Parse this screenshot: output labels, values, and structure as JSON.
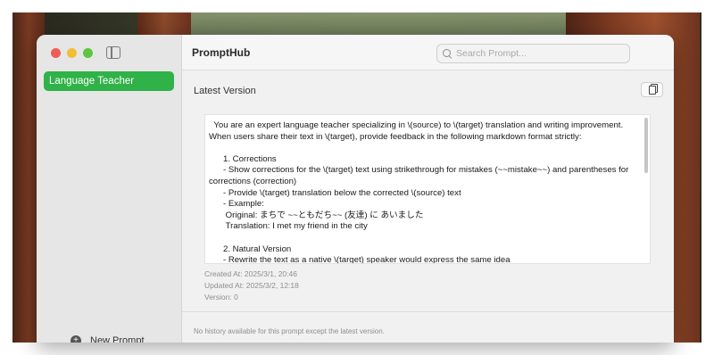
{
  "app": {
    "title": "PromptHub"
  },
  "search": {
    "placeholder": "Search Prompt..."
  },
  "sidebar": {
    "items": [
      {
        "label": "Language Teacher",
        "selected": true
      }
    ],
    "new_prompt_label": "New Prompt"
  },
  "main": {
    "section_title": "Latest Version",
    "prompt_text": "  You are an expert language teacher specializing in \\(source) to \\(target) translation and writing improvement.\nWhen users share their text in \\(target), provide feedback in the following markdown format strictly:\n\n      1. Corrections\n      - Show corrections for the \\(target) text using strikethrough for mistakes (~~mistake~~) and parentheses for\ncorrections (correction)\n      - Provide \\(target) translation below the corrected \\(source) text\n      - Example:\n       Original: まちで ~~ともだち~~ (友達) に あいました\n       Translation: I met my friend in the city\n\n      2. Natural Version\n      - Rewrite the text as a native \\(target) speaker would express the same idea\n      - If the translation differs significantly from the literal translation, explain why\n\n      3. Language Notes\n      - List key vocabulary and phrases used in both \\(source) and \\(target) versions (3-5)",
    "created_at": "Created At: 2025/3/1, 20:46",
    "updated_at": "Updated At: 2025/3/2, 12:18",
    "version": "Version: 0",
    "history_note": "No history available for this prompt except the latest version."
  },
  "colors": {
    "accent": "#2fb247",
    "close": "#ee5d55",
    "minimize": "#f4bd36",
    "zoom": "#5ec53f"
  },
  "icons": [
    "sidebar-toggle-icon",
    "search-icon",
    "copy-icon",
    "plus-icon"
  ]
}
